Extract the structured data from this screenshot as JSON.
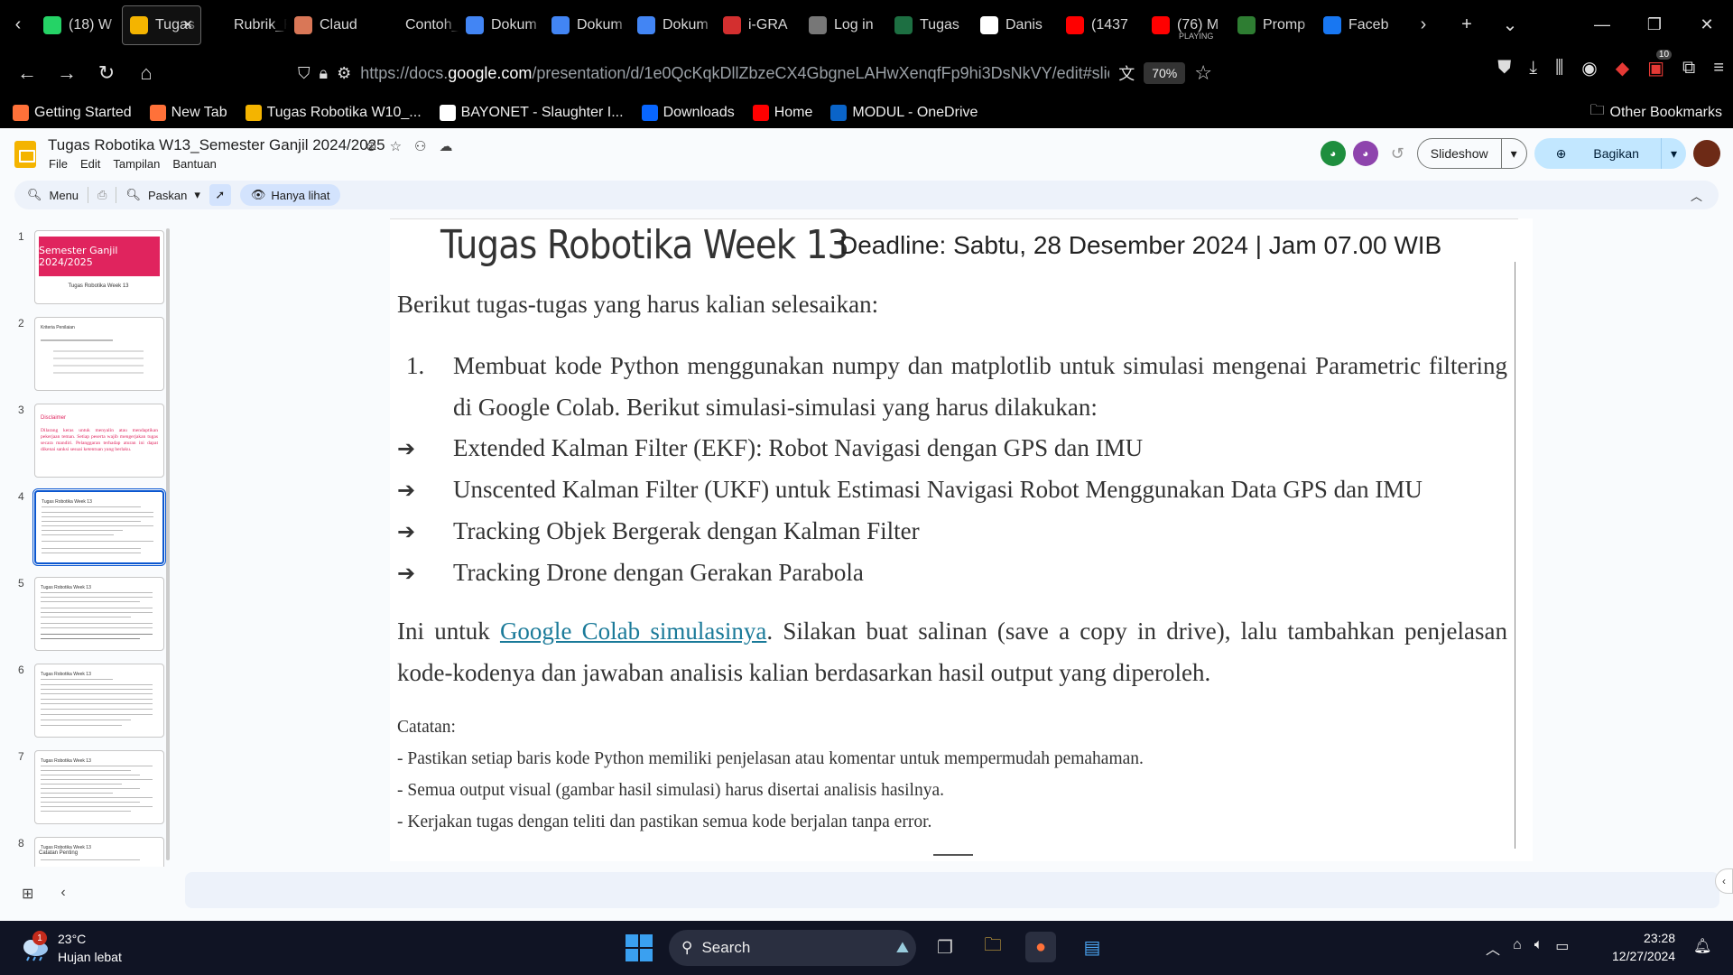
{
  "browser": {
    "tabs": [
      {
        "label": "(18) W",
        "favicon": "whatsapp-icon",
        "color": "#25d366",
        "active": false
      },
      {
        "label": "Tugas",
        "favicon": "google-slides-icon",
        "color": "#f4b400",
        "active": true
      },
      {
        "label": "Rubrik_Pe",
        "favicon": "blank-page-icon",
        "color": "#000000",
        "active": false
      },
      {
        "label": "Claud",
        "favicon": "claude-icon",
        "color": "#d97757",
        "active": false
      },
      {
        "label": "Contoh_C",
        "favicon": "blank-page-icon",
        "color": "#000000",
        "active": false
      },
      {
        "label": "Dokum",
        "favicon": "google-docs-icon",
        "color": "#4285f4",
        "active": false
      },
      {
        "label": "Dokum",
        "favicon": "google-docs-icon",
        "color": "#4285f4",
        "active": false
      },
      {
        "label": "Dokum",
        "favicon": "google-docs-icon",
        "color": "#4285f4",
        "active": false
      },
      {
        "label": "i-GRA",
        "favicon": "igracias-icon",
        "color": "#d32f2f",
        "active": false
      },
      {
        "label": "Log in",
        "favicon": "login-icon",
        "color": "#777777",
        "active": false
      },
      {
        "label": "Tugas",
        "favicon": "excel-icon",
        "color": "#1d6f42",
        "active": false
      },
      {
        "label": "Danis",
        "favicon": "github-icon",
        "color": "#ffffff",
        "active": false
      },
      {
        "label": "(1437",
        "favicon": "youtube-icon",
        "color": "#ff0000",
        "active": false
      },
      {
        "label": "(76) M",
        "sublabel": "PLAYING",
        "favicon": "youtube-icon",
        "color": "#ff0000",
        "active": false
      },
      {
        "label": "Promp",
        "favicon": "promo-icon",
        "color": "#2e7d32",
        "active": false
      },
      {
        "label": "Faceb",
        "favicon": "facebook-icon",
        "color": "#1877f2",
        "active": false
      }
    ],
    "url_prefix": "https://docs.",
    "url_domain": "google.com",
    "url_path": "/presentation/d/1e0QcKqkDllZbzeCX4GbgneLAHwXenqfFp9hi3DsNkVY/edit#slide=id",
    "zoom": "70%",
    "extension_badge": "10",
    "bookmarks": [
      {
        "label": "Getting Started",
        "icon": "firefox-icon",
        "color": "#ff7139"
      },
      {
        "label": "New Tab",
        "icon": "firefox-icon",
        "color": "#ff7139"
      },
      {
        "label": "Tugas Robotika W10_...",
        "icon": "google-slides-icon",
        "color": "#f4b400"
      },
      {
        "label": "BAYONET - Slaughter I...",
        "icon": "google-icon",
        "color": "#ffffff"
      },
      {
        "label": "Downloads",
        "icon": "meta-icon",
        "color": "#0866ff"
      },
      {
        "label": "Home",
        "icon": "youtube-icon",
        "color": "#ff0000"
      },
      {
        "label": "MODUL - OneDrive",
        "icon": "onedrive-icon",
        "color": "#0a64c8"
      }
    ],
    "other_bookmarks": "Other Bookmarks"
  },
  "app": {
    "doc_title": "Tugas Robotika W13_Semester Ganjil 2024/2025",
    "menus": [
      "File",
      "Edit",
      "Tampilan",
      "Bantuan"
    ],
    "slideshow_label": "Slideshow",
    "share_label": "Bagikan",
    "toolbar": {
      "menu_label": "Menu",
      "fit_label": "Paskan",
      "view_only_label": "Hanya lihat"
    }
  },
  "thumbnails": [
    {
      "num": "1",
      "title": "Semester Ganjil 2024/2025",
      "subtitle": "Tugas Robotika Week 13"
    },
    {
      "num": "2",
      "title": "Kriteria Penilaian"
    },
    {
      "num": "3",
      "title": "Disclaimer",
      "body": "Dilarang keras untuk menyalin atau mendaptikan pekerjaan teman. Setiap peserta wajib mengerjakan tugas secara mandiri. Pelanggaran terhadap aturan ini dapat dikenai sanksi sesuai ketentuan yang berlaku."
    },
    {
      "num": "4",
      "title": "Tugas Robotika Week 13",
      "selected": true
    },
    {
      "num": "5",
      "title": "Tugas Robotika Week 13"
    },
    {
      "num": "6",
      "title": "Tugas Robotika Week 13"
    },
    {
      "num": "7",
      "title": "Tugas Robotika Week 13"
    },
    {
      "num": "8",
      "title": "Tugas Robotika Week 13",
      "body": "Catatan Penting"
    }
  ],
  "slide": {
    "title": "Tugas Robotika Week 13",
    "deadline": "Deadline: Sabtu, 28 Desember 2024  | Jam 07.00 WIB",
    "intro": "Berikut tugas-tugas yang harus kalian selesaikan:",
    "item_number": "1.",
    "item_text": "Membuat kode Python menggunakan numpy dan matplotlib untuk simulasi mengenai Parametric filtering  di Google Colab. Berikut simulasi-simulasi yang harus dilakukan:",
    "bullet_symbol": "➔",
    "bullets": [
      "Extended Kalman Filter (EKF): Robot Navigasi dengan GPS dan IMU",
      "Unscented Kalman Filter (UKF) untuk Estimasi Navigasi Robot Menggunakan Data GPS dan IMU",
      "Tracking Objek Bergerak dengan Kalman Filter",
      "Tracking Drone dengan Gerakan Parabola"
    ],
    "para_before": "Ini untuk ",
    "link_text": "Google Colab simulasinya",
    "para_after": ". Silakan buat salinan (save a copy in drive), lalu tambahkan penjelasan kode-kodenya dan jawaban analisis kalian berdasarkan hasil output yang diperoleh.",
    "notes_title": "Catatan:",
    "notes": [
      "- Pastikan setiap baris kode Python memiliki penjelasan atau komentar untuk mempermudah pemahaman.",
      "- Semua output visual (gambar hasil simulasi) harus disertai analisis hasilnya.",
      "- Kerjakan tugas dengan teliti dan pastikan semua kode berjalan tanpa error."
    ]
  },
  "taskbar": {
    "weather_temp": "23°C",
    "weather_desc": "Hujan lebat",
    "weather_badge": "1",
    "search_label": "Search",
    "time": "23:28",
    "date": "12/27/2024"
  }
}
